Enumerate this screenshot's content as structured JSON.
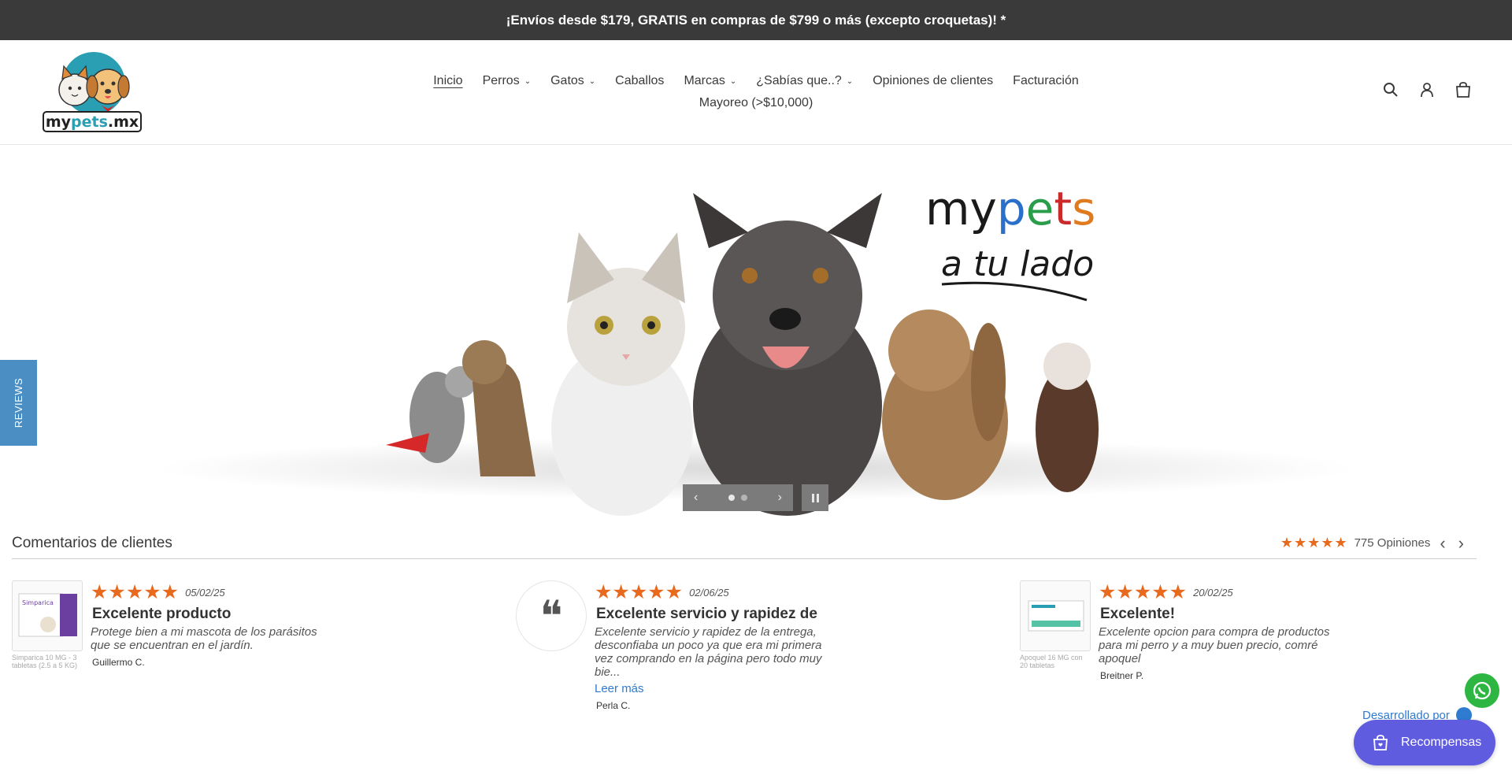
{
  "announcement": "¡Envíos desde $179, GRATIS en compras de $799 o más (excepto croquetas)! *",
  "logo": {
    "text_my": "my",
    "text_pets": "pets",
    "text_mx": ".mx"
  },
  "nav": {
    "row1": [
      "Inicio",
      "Perros",
      "Gatos",
      "Caballos",
      "Marcas",
      "¿Sabías que..?",
      "Opiniones de clientes",
      "Facturación"
    ],
    "row2": [
      "Mayoreo (>$10,000)"
    ]
  },
  "hero": {
    "brand": "mypets",
    "tagline": "a tu lado"
  },
  "side_tab": "REVIEWS",
  "reviews": {
    "heading": "Comentarios de clientes",
    "count_label": "775 Opiniones",
    "items": [
      {
        "date": "05/02/25",
        "title": "Excelente producto",
        "text": "Protege bien a mi mascota de los parásitos que se encuentran en el jardín.",
        "author": "Guillermo C.",
        "product_caption": "Simparica 10 MG - 3 tabletas (2.5 a 5 KG)"
      },
      {
        "date": "02/06/25",
        "title": "Excelente servicio y rapidez de",
        "text": "Excelente servicio y rapidez de la entrega, desconfiaba un poco ya que era mi primera vez comprando en la página pero todo muy bie...",
        "more": "Leer más",
        "author": "Perla C."
      },
      {
        "date": "20/02/25",
        "title": "Excelente!",
        "text": "Excelente opcion para compra de productos para mi perro y a muy buen precio, comré apoquel",
        "author": "Breitner P.",
        "product_caption": "Apoquel 16 MG con 20 tabletas"
      }
    ]
  },
  "powered_by": "Desarrollado por",
  "rewards_label": "Recompensas",
  "colors": {
    "star": "#e86a1f",
    "link": "#2e7bd0",
    "rewards": "#5f5ce0",
    "whatsapp": "#2db742",
    "bar": "#3a3a3a"
  }
}
